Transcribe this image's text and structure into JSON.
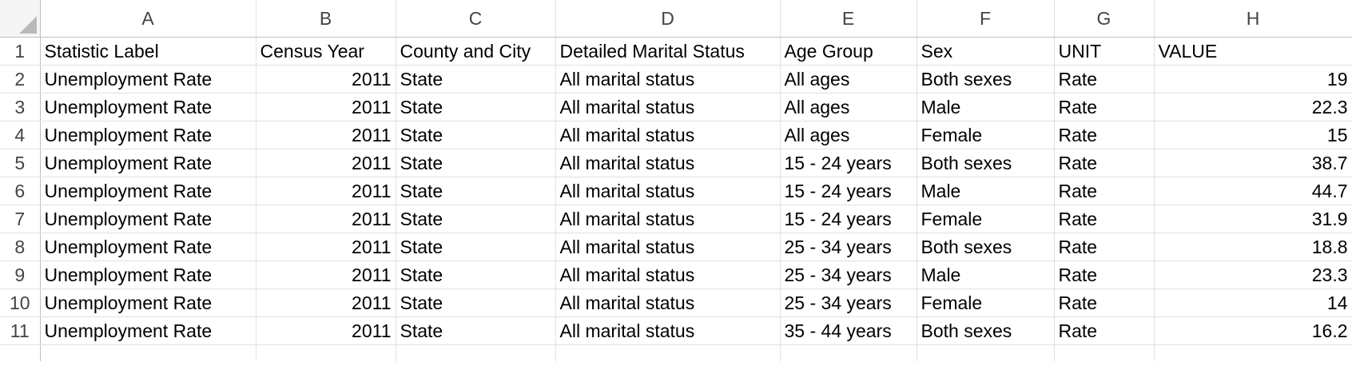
{
  "sheet": {
    "column_letters": [
      "A",
      "B",
      "C",
      "D",
      "E",
      "F",
      "G",
      "H"
    ],
    "rows": [
      {
        "num": "1",
        "cells": [
          "Statistic Label",
          "Census Year",
          "County and City",
          "Detailed Marital Status",
          "Age Group",
          "Sex",
          "UNIT",
          "VALUE"
        ],
        "header": true
      },
      {
        "num": "2",
        "cells": [
          "Unemployment Rate",
          "2011",
          "State",
          "All marital status",
          "All ages",
          "Both sexes",
          "Rate",
          "19"
        ]
      },
      {
        "num": "3",
        "cells": [
          "Unemployment Rate",
          "2011",
          "State",
          "All marital status",
          "All ages",
          "Male",
          "Rate",
          "22.3"
        ]
      },
      {
        "num": "4",
        "cells": [
          "Unemployment Rate",
          "2011",
          "State",
          "All marital status",
          "All ages",
          "Female",
          "Rate",
          "15"
        ]
      },
      {
        "num": "5",
        "cells": [
          "Unemployment Rate",
          "2011",
          "State",
          "All marital status",
          "15 - 24 years",
          "Both sexes",
          "Rate",
          "38.7"
        ]
      },
      {
        "num": "6",
        "cells": [
          "Unemployment Rate",
          "2011",
          "State",
          "All marital status",
          "15 - 24 years",
          "Male",
          "Rate",
          "44.7"
        ]
      },
      {
        "num": "7",
        "cells": [
          "Unemployment Rate",
          "2011",
          "State",
          "All marital status",
          "15 - 24 years",
          "Female",
          "Rate",
          "31.9"
        ]
      },
      {
        "num": "8",
        "cells": [
          "Unemployment Rate",
          "2011",
          "State",
          "All marital status",
          "25 - 34 years",
          "Both sexes",
          "Rate",
          "18.8"
        ]
      },
      {
        "num": "9",
        "cells": [
          "Unemployment Rate",
          "2011",
          "State",
          "All marital status",
          "25 - 34 years",
          "Male",
          "Rate",
          "23.3"
        ]
      },
      {
        "num": "10",
        "cells": [
          "Unemployment Rate",
          "2011",
          "State",
          "All marital status",
          "25 - 34 years",
          "Female",
          "Rate",
          "14"
        ]
      },
      {
        "num": "11",
        "cells": [
          "Unemployment Rate",
          "2011",
          "State",
          "All marital status",
          "35 - 44 years",
          "Both sexes",
          "Rate",
          "16.2"
        ]
      }
    ]
  }
}
